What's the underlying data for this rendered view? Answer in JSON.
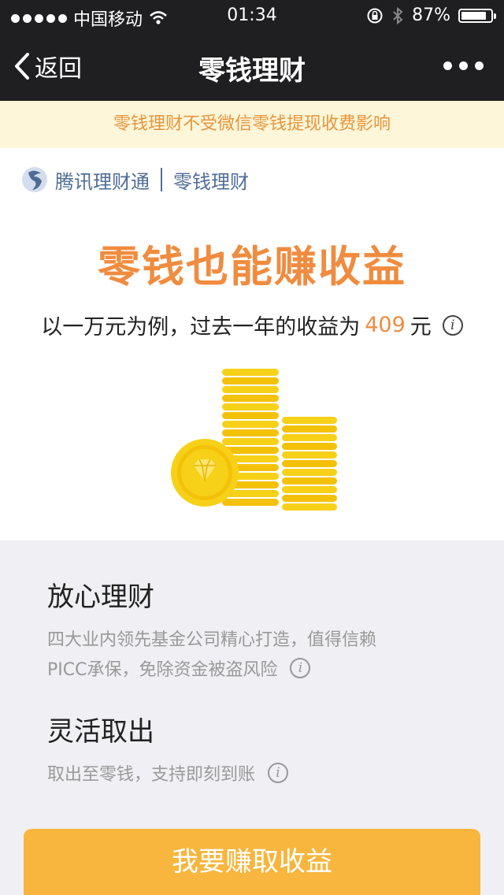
{
  "status": {
    "carrier": "中国移动",
    "time": "01:34",
    "battery": "87%",
    "battery_level": 0.87
  },
  "nav": {
    "back_label": "返回",
    "title": "零钱理财"
  },
  "notice": "零钱理财不受微信零钱提现收费影响",
  "brand": {
    "name": "腾讯理财通",
    "product": "零钱理财"
  },
  "hero": {
    "headline": "零钱也能赚收益",
    "sub_prefix": "以一万元为例，过去一年的收益为",
    "amount": "409",
    "unit": "元"
  },
  "features": [
    {
      "title": "放心理财",
      "lines": [
        "四大业内领先基金公司精心打造，值得信赖",
        "PICC承保，免除资金被盗风险"
      ]
    },
    {
      "title": "灵活取出",
      "lines": [
        "取出至零钱，支持即刻到账"
      ]
    }
  ],
  "cta_label": "我要赚取收益",
  "colors": {
    "accent": "#f08c3f",
    "cta": "#f8b63e",
    "nav_bg": "#1f1f21",
    "notice_bg": "#fdf6d9",
    "brand": "#4f6d96",
    "coin": "#f7d117"
  },
  "icons": [
    "signal-dots-icon",
    "wifi-icon",
    "rotation-lock-icon",
    "bluetooth-icon",
    "battery-icon",
    "back-chevron-icon",
    "more-dots-icon",
    "tencent-licaitong-logo-icon",
    "info-icon",
    "coin-stack-icon",
    "diamond-coin-icon"
  ]
}
